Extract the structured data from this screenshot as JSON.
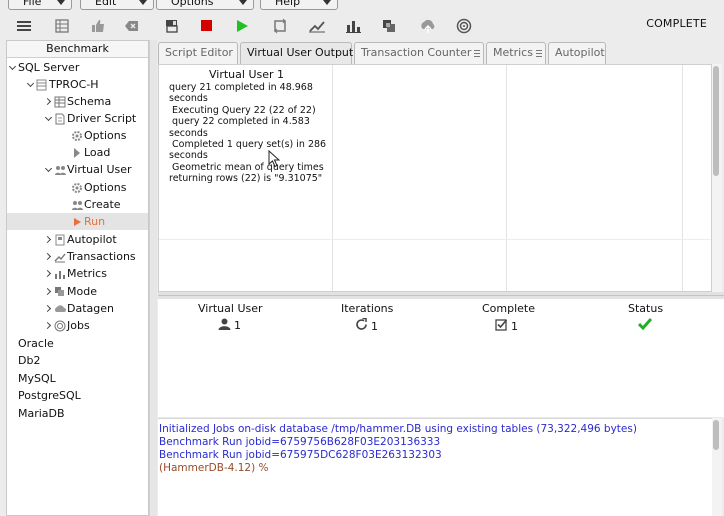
{
  "menubar": {
    "items": [
      {
        "label": "File"
      },
      {
        "label": "Edit"
      },
      {
        "label": "Options"
      },
      {
        "label": "Help"
      }
    ]
  },
  "toolbar": {
    "status": "COMPLETE",
    "buttons": [
      {
        "icon": "hamburger-menu-icon"
      },
      {
        "icon": "grid-icon"
      },
      {
        "icon": "thumbs-up-icon"
      },
      {
        "icon": "clear-icon"
      },
      {
        "icon": "script-icon"
      },
      {
        "icon": "stop-icon",
        "color": "#d40000"
      },
      {
        "icon": "run-icon",
        "color": "#22c022"
      },
      {
        "icon": "loop-icon"
      },
      {
        "icon": "line-chart-icon"
      },
      {
        "icon": "bar-chart-icon"
      },
      {
        "icon": "stack-icon"
      },
      {
        "icon": "upload-icon"
      },
      {
        "icon": "target-icon"
      }
    ]
  },
  "tree": {
    "header": "Benchmark",
    "nodes": [
      {
        "label": "SQL Server",
        "expanded": true
      },
      {
        "label": "TPROC-H",
        "expanded": true,
        "icon": "database-icon"
      },
      {
        "label": "Schema",
        "icon": "schema-icon"
      },
      {
        "label": "Driver Script",
        "expanded": true,
        "icon": "document-icon"
      },
      {
        "label": "Options",
        "icon": "gear-icon"
      },
      {
        "label": "Load",
        "icon": "load-icon"
      },
      {
        "label": "Virtual User",
        "expanded": true,
        "icon": "users-icon"
      },
      {
        "label": "Options",
        "icon": "gear-icon"
      },
      {
        "label": "Create",
        "icon": "users-create-icon"
      },
      {
        "label": "Run",
        "icon": "run-icon",
        "selected": true,
        "color": "#e8703a"
      },
      {
        "label": "Autopilot",
        "icon": "autopilot-icon"
      },
      {
        "label": "Transactions",
        "icon": "transactions-icon"
      },
      {
        "label": "Metrics",
        "icon": "metrics-icon"
      },
      {
        "label": "Mode",
        "icon": "mode-icon"
      },
      {
        "label": "Datagen",
        "icon": "datagen-icon"
      },
      {
        "label": "Jobs",
        "icon": "jobs-icon"
      },
      {
        "label": "Oracle"
      },
      {
        "label": "Db2"
      },
      {
        "label": "MySQL"
      },
      {
        "label": "PostgreSQL"
      },
      {
        "label": "MariaDB"
      }
    ]
  },
  "tabs": [
    {
      "label": "Script Editor"
    },
    {
      "label": "Virtual User Output",
      "active": true
    },
    {
      "label": "Transaction Counter"
    },
    {
      "label": "Metrics"
    },
    {
      "label": "Autopilot"
    }
  ],
  "vu_output": {
    "title": "Virtual User 1",
    "log": "query 21 completed in 48.968\nseconds\n Executing Query 22 (22 of 22)\n query 22 completed in 4.583\nseconds\n Completed 1 query set(s) in 286\nseconds\n Geometric mean of query times\nreturning rows (22) is \"9.31075\""
  },
  "vu_table": {
    "headers": [
      "Virtual User",
      "Iterations",
      "Complete",
      "Status"
    ],
    "row": {
      "virtual_user": "1",
      "iterations": "1",
      "complete": "1",
      "status": "check"
    }
  },
  "console": {
    "lines": [
      {
        "text": "Initialized Jobs on-disk database /tmp/hammer.DB using existing tables (73,322,496 bytes)",
        "color": "#2a2ad0"
      },
      {
        "text": "Benchmark Run jobid=6759756B628F03E203136333",
        "color": "#2a2ad0"
      },
      {
        "text": "Benchmark Run jobid=675975DC628F03E263132303",
        "color": "#2a2ad0"
      },
      {
        "text": "(HammerDB-4.12) %",
        "color": "#9a4a2a"
      }
    ]
  }
}
